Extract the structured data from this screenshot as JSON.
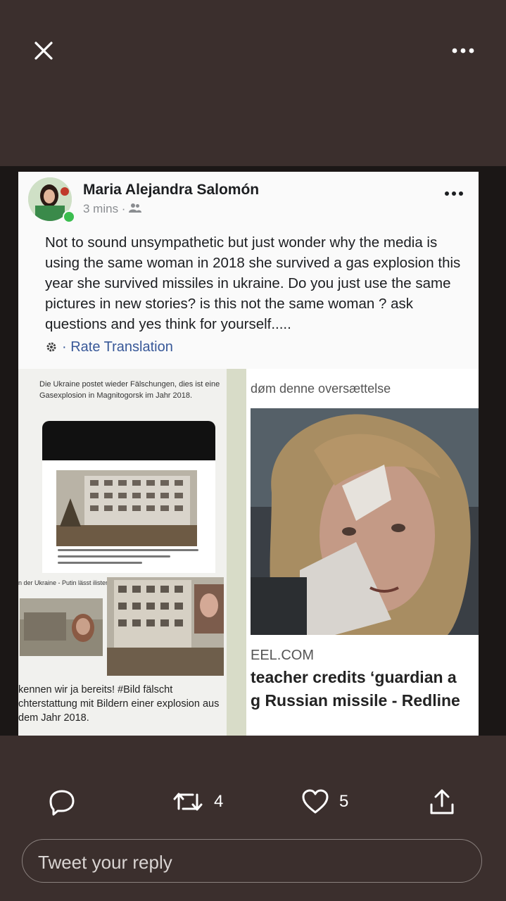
{
  "topbar": {
    "close_icon": "close-icon",
    "more_icon": "more-icon"
  },
  "post": {
    "author": "Maria Alejandra Salomón",
    "time": "3 mins ·",
    "text": "Not to sound unsympathetic but just wonder why the media is using the same woman in 2018 she survived a gas explosion this year she survived missiles in ukraine. Do you just use the same pictures in new stories? is this not the same woman ? ask questions and yes think for yourself.....",
    "rate_translation": "· Rate Translation",
    "left_caption": "Die Ukraine postet wieder Fälschungen, dies ist eine Gasexplosion in Magnitogorsk im Jahr 2018.",
    "left_small": "n der Ukraine - Putin lässt ilisten schießen",
    "left_bottom": "kennen wir ja bereits! #Bild fälscht chterstattung mit Bildern einer explosion aus dem Jahr 2018.",
    "right_top": "døm denne oversættelse",
    "right_source": "EEL.COM",
    "right_headline_1": "teacher credits ‘guardian a",
    "right_headline_2": "g Russian missile - Redline"
  },
  "actions": {
    "reply_icon": "reply-icon",
    "retweet_count": "4",
    "like_count": "5",
    "share_icon": "share-icon"
  },
  "reply_box": {
    "placeholder": "Tweet your reply"
  },
  "colors": {
    "background": "#3b2f2d",
    "link": "#385898",
    "online": "#3bbd4f"
  }
}
